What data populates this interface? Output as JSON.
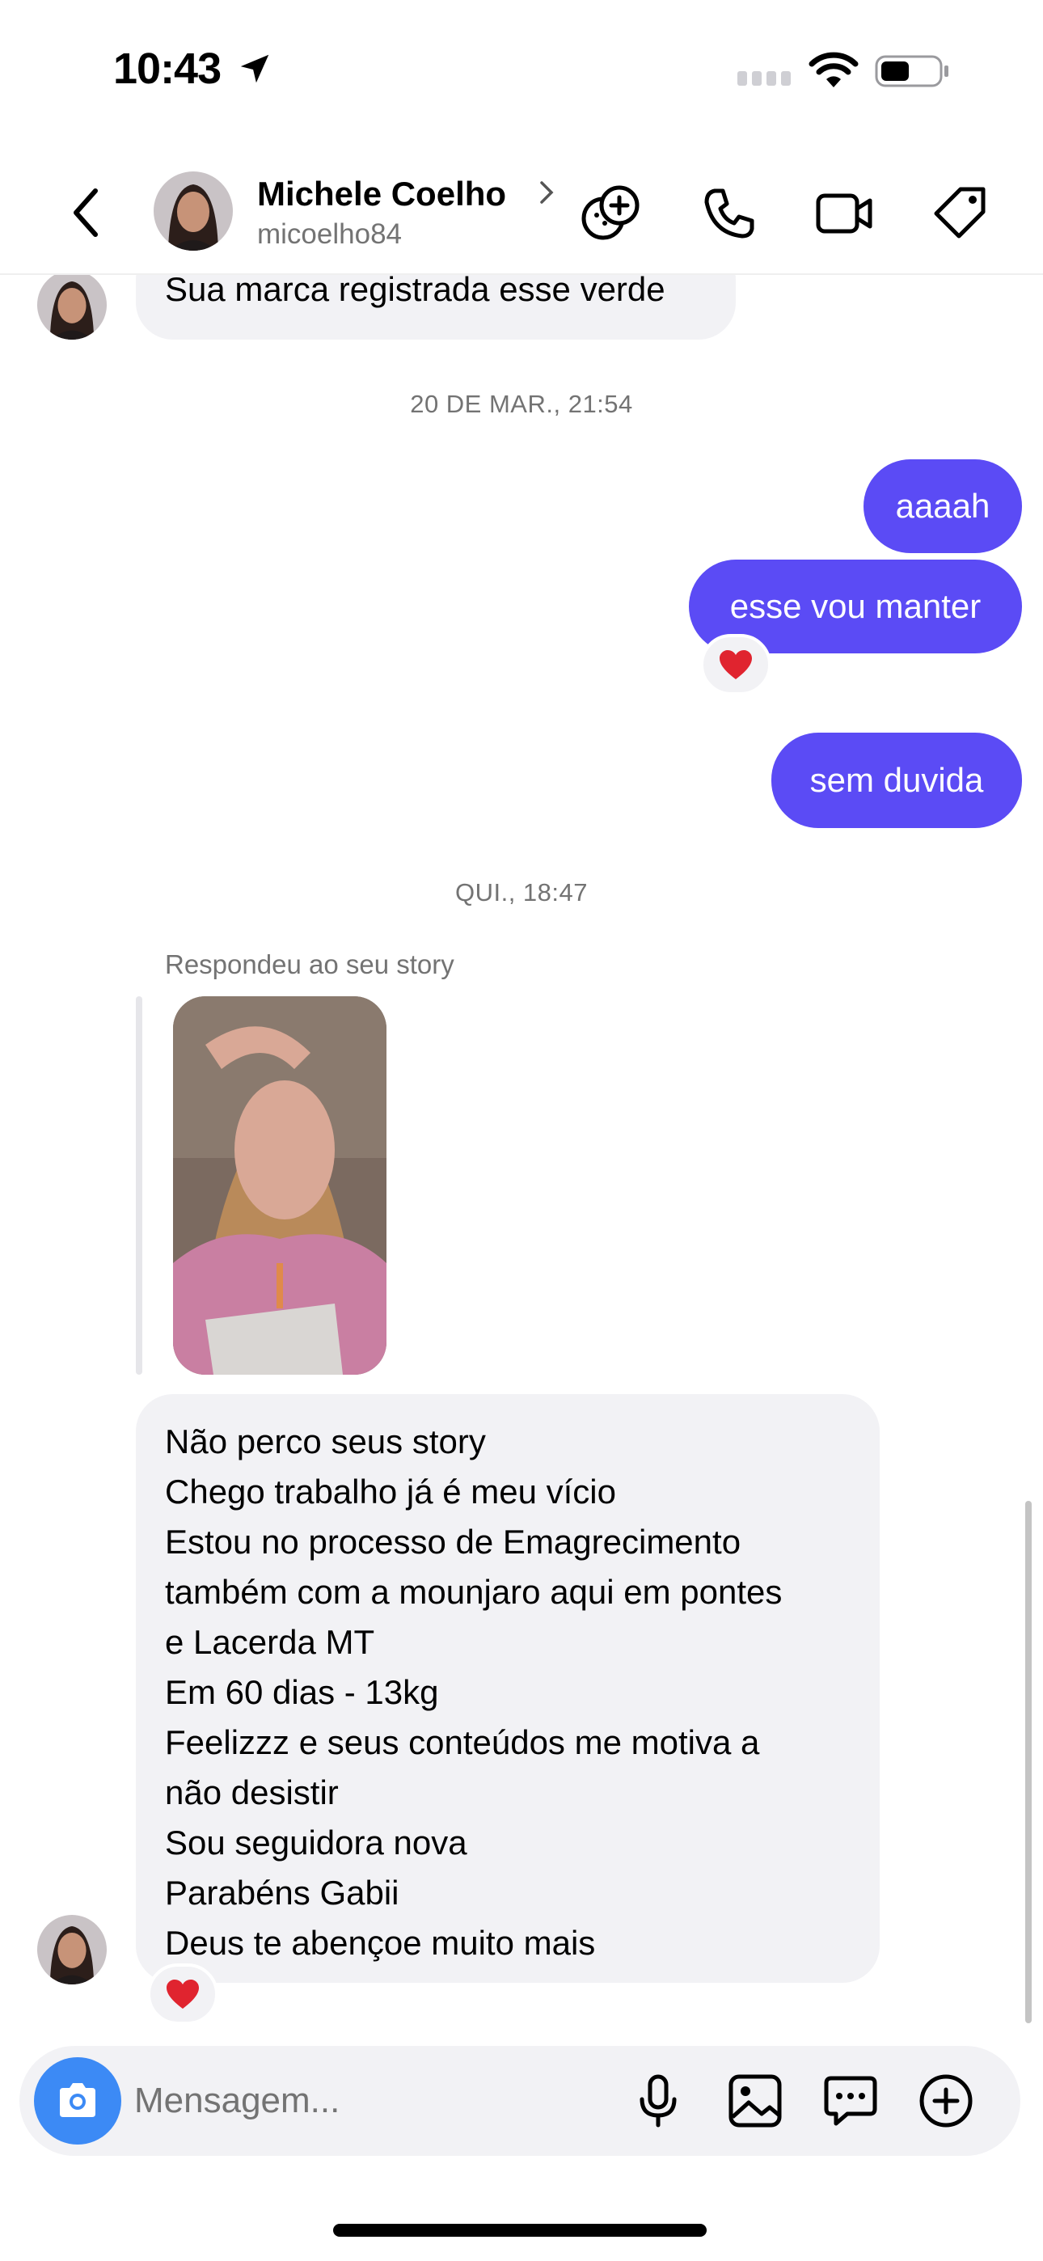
{
  "status_bar": {
    "time": "10:43",
    "icons": [
      "location-arrow-icon",
      "signal-icon",
      "wifi-icon",
      "battery-icon"
    ]
  },
  "header": {
    "contact_name": "Michele Coelho",
    "username": "micoelho84",
    "icons": [
      "back-icon",
      "chevron-right-icon",
      "effects-icon",
      "phone-icon",
      "video-icon",
      "tag-icon"
    ]
  },
  "messages": {
    "first_incoming": "Sua marca registrada esse verde",
    "timestamp_1": "20 DE MAR., 21:54",
    "outgoing": [
      "aaaah",
      "esse vou manter",
      "sem duvida"
    ],
    "timestamp_2": "QUI., 18:47",
    "reply_label": "Respondeu ao seu story",
    "long_message_lines": [
      "Não perco seus story",
      "Chego trabalho já é meu vício",
      "Estou no processo de Emagrecimento",
      "também com a mounjaro aqui em pontes",
      "e Lacerda MT",
      "Em 60 dias - 13kg",
      "Feelizzz e seus conteúdos me motiva a",
      "não desistir",
      "Sou seguidora nova",
      "Parabéns Gabii",
      "Deus te abençoe muito mais"
    ],
    "reaction": "heart-icon"
  },
  "composer": {
    "placeholder": "Mensagem..."
  },
  "colors": {
    "outgoing_bubble": "#5b4bf5",
    "incoming_bubble": "#f2f2f5",
    "camera_button": "#3c8af5",
    "reaction_heart": "#e0242f"
  }
}
